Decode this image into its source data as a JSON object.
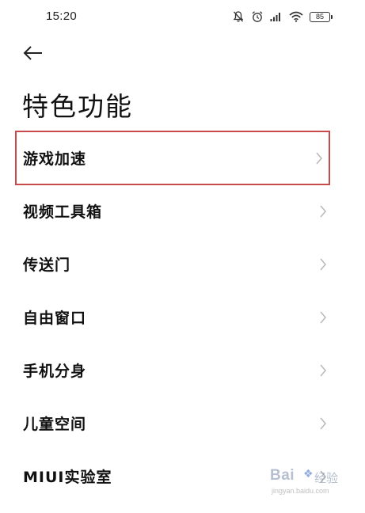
{
  "status_bar": {
    "time": "15:20",
    "battery": "85",
    "icons": [
      "notifications-off-icon",
      "alarm-icon",
      "signal-icon",
      "wifi-icon",
      "battery-icon"
    ]
  },
  "header": {
    "back_icon": "arrow-left-icon",
    "title": "特色功能"
  },
  "menu": {
    "items": [
      {
        "label": "游戏加速",
        "highlighted": true
      },
      {
        "label": "视频工具箱"
      },
      {
        "label": "传送门"
      },
      {
        "label": "自由窗口"
      },
      {
        "label": "手机分身"
      },
      {
        "label": "儿童空间"
      },
      {
        "label": "MIUI实验室"
      }
    ],
    "chevron_icon": "chevron-right-icon"
  },
  "watermark": {
    "logo_text": "Bai",
    "logo_suffix": "经验",
    "url": "jingyan.baidu.com"
  },
  "colors": {
    "background": "#ffffff",
    "text": "#111111",
    "highlight_border": "#c94a4a",
    "chevron": "#b8b8b8"
  }
}
